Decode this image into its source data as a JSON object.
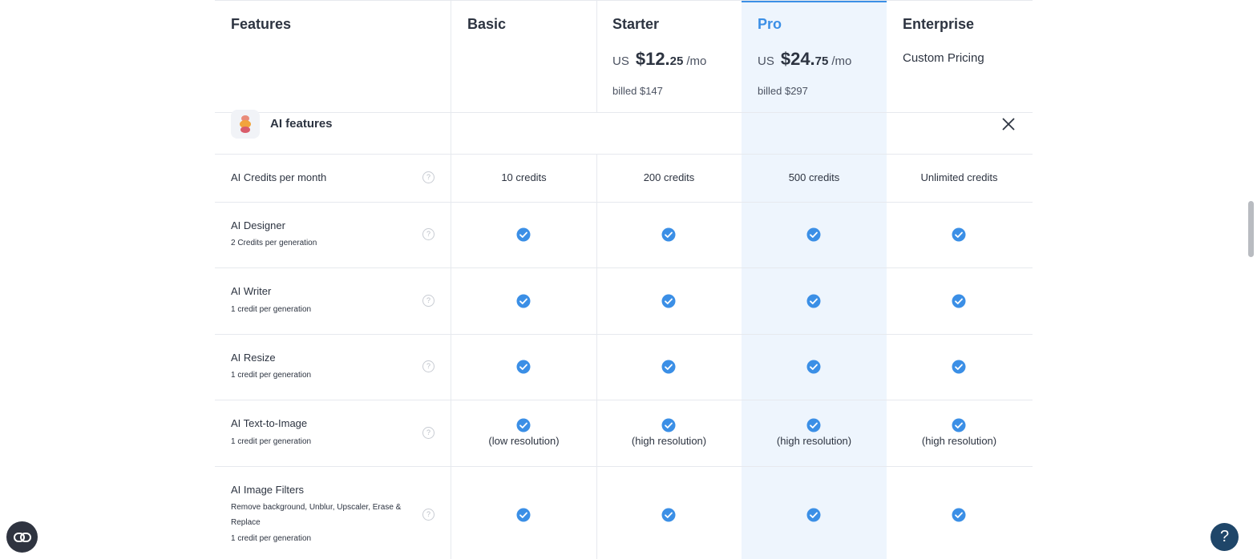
{
  "header": {
    "features_label": "Features",
    "plans": [
      {
        "name": "Basic"
      },
      {
        "name": "Starter",
        "currency": "US",
        "amount": "$12.",
        "cents": "25",
        "period": "/mo",
        "billed": "billed $147"
      },
      {
        "name": "Pro",
        "currency": "US",
        "amount": "$24.",
        "cents": "75",
        "period": "/mo",
        "billed": "billed $297"
      },
      {
        "name": "Enterprise",
        "custom": "Custom Pricing"
      }
    ]
  },
  "section": {
    "title": "AI features",
    "icon": "ai-features-icon"
  },
  "rows": [
    {
      "name": "AI Credits per month",
      "sub": "",
      "values": [
        "10 credits",
        "200 credits",
        "500 credits",
        "Unlimited credits"
      ]
    },
    {
      "name": "AI Designer",
      "sub": "2 Credits per generation",
      "values": [
        "check",
        "check",
        "check",
        "check"
      ]
    },
    {
      "name": "AI Writer",
      "sub": "1 credit per generation",
      "values": [
        "check",
        "check",
        "check",
        "check"
      ]
    },
    {
      "name": "AI Resize",
      "sub": "1 credit per generation",
      "values": [
        "check",
        "check",
        "check",
        "check"
      ]
    },
    {
      "name": "AI Text-to-Image",
      "sub": "1 credit per generation",
      "values": [
        "check",
        "check",
        "check",
        "check"
      ],
      "notes": [
        "(low resolution)",
        "(high resolution)",
        "(high resolution)",
        "(high resolution)"
      ]
    },
    {
      "name": "AI Image Filters",
      "sub": "Remove background, Unblur, Upscaler, Erase & Replace",
      "sub2": "1 credit per generation",
      "values": [
        "check",
        "check",
        "check",
        "check"
      ]
    }
  ],
  "help_glyph": "?",
  "fab_help_glyph": "?",
  "colors": {
    "accent": "#3b8fe6",
    "pro_column": "#eef5fd",
    "check": "#3b8fe6",
    "text": "#2d3441",
    "border": "#e6e9ee"
  }
}
